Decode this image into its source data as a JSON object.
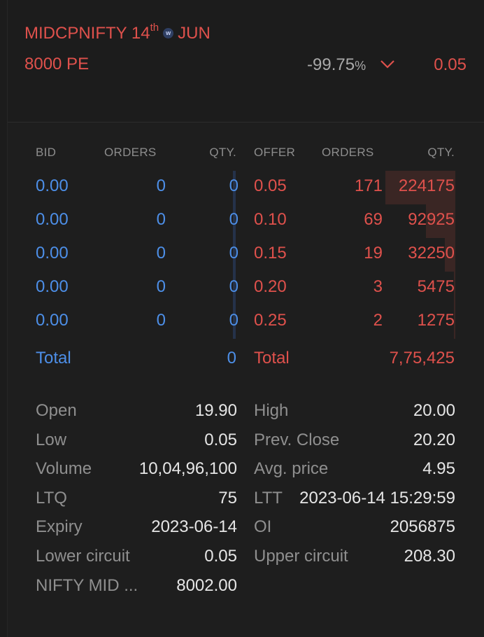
{
  "instrument": {
    "name": "MIDCPNIFTY 14",
    "name_suffix": "th",
    "weekly_badge": "w",
    "month": "JUN",
    "strike": "8000 PE",
    "change_value": "-99.75",
    "change_unit": "%",
    "ltp": "0.05"
  },
  "depth": {
    "headers": {
      "bid": "BID",
      "bid_orders": "ORDERS",
      "bid_qty": "QTY.",
      "offer": "OFFER",
      "offer_orders": "ORDERS",
      "offer_qty": "QTY."
    },
    "rows": [
      {
        "bid": "0.00",
        "bid_orders": "0",
        "bid_qty": "0",
        "offer": "0.05",
        "offer_orders": "171",
        "offer_qty": "224175",
        "offer_share": 0.289
      },
      {
        "bid": "0.00",
        "bid_orders": "0",
        "bid_qty": "0",
        "offer": "0.10",
        "offer_orders": "69",
        "offer_qty": "92925",
        "offer_share": 0.12
      },
      {
        "bid": "0.00",
        "bid_orders": "0",
        "bid_qty": "0",
        "offer": "0.15",
        "offer_orders": "19",
        "offer_qty": "32250",
        "offer_share": 0.042
      },
      {
        "bid": "0.00",
        "bid_orders": "0",
        "bid_qty": "0",
        "offer": "0.20",
        "offer_orders": "3",
        "offer_qty": "5475",
        "offer_share": 0.007
      },
      {
        "bid": "0.00",
        "bid_orders": "0",
        "bid_qty": "0",
        "offer": "0.25",
        "offer_orders": "2",
        "offer_qty": "1275",
        "offer_share": 0.002
      }
    ],
    "total_label_bid": "Total",
    "total_bid": "0",
    "total_label_offer": "Total",
    "total_offer": "7,75,425"
  },
  "stats": {
    "left": [
      {
        "label": "Open",
        "value": "19.90"
      },
      {
        "label": "Low",
        "value": "0.05"
      },
      {
        "label": "Volume",
        "value": "10,04,96,100"
      },
      {
        "label": "LTQ",
        "value": "75"
      },
      {
        "label": "Expiry",
        "value": "2023-06-14"
      },
      {
        "label": "Lower circuit",
        "value": "0.05"
      },
      {
        "label": "NIFTY MID ...",
        "value": "8002.00"
      }
    ],
    "right": [
      {
        "label": "High",
        "value": "20.00"
      },
      {
        "label": "Prev. Close",
        "value": "20.20"
      },
      {
        "label": "Avg. price",
        "value": "4.95"
      },
      {
        "label": "LTT",
        "value": "2023-06-14 15:29:59"
      },
      {
        "label": "OI",
        "value": "2056875"
      },
      {
        "label": "Upper circuit",
        "value": "208.30"
      }
    ]
  },
  "colors": {
    "bid": "#4d8fe8",
    "offer": "#df514c",
    "label": "#8f8f8f",
    "value": "#e6e6e6"
  }
}
